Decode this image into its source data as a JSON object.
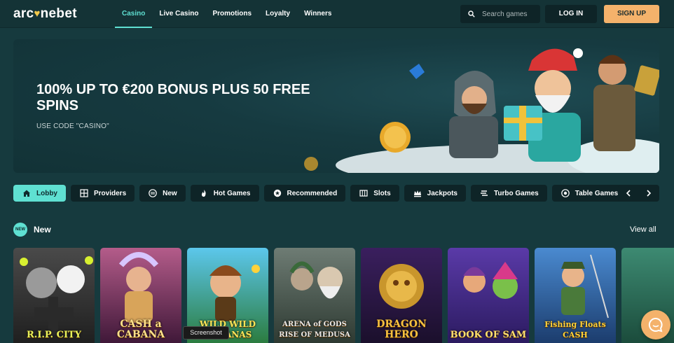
{
  "header": {
    "logo_left": "arc",
    "logo_heart": "♥",
    "logo_right": "nebet",
    "nav": [
      {
        "label": "Casino",
        "active": true
      },
      {
        "label": "Live Casino"
      },
      {
        "label": "Promotions"
      },
      {
        "label": "Loyalty"
      },
      {
        "label": "Winners"
      }
    ],
    "search_placeholder": "Search games",
    "login_label": "LOG IN",
    "signup_label": "SIGN UP"
  },
  "banner": {
    "title": "100% UP TO €200 BONUS PLUS 50 FREE SPINS",
    "subtitle": "USE CODE \"CASINO\""
  },
  "categories": [
    {
      "label": "Lobby",
      "icon": "home-icon",
      "active": true
    },
    {
      "label": "Providers",
      "icon": "grid-icon"
    },
    {
      "label": "New",
      "icon": "new-icon"
    },
    {
      "label": "Hot Games",
      "icon": "flame-icon"
    },
    {
      "label": "Recommended",
      "icon": "star-badge-icon"
    },
    {
      "label": "Slots",
      "icon": "slot-machine-icon"
    },
    {
      "label": "Jackpots",
      "icon": "crown-icon"
    },
    {
      "label": "Turbo Games",
      "icon": "turbo-icon"
    },
    {
      "label": "Table Games",
      "icon": "table-icon"
    }
  ],
  "section": {
    "badge": "NEW",
    "title": "New",
    "view_all": "View all"
  },
  "games": [
    {
      "name": "R.I.P. CITY",
      "bg": "#3a3a3a"
    },
    {
      "name": "CASH a CABANA",
      "bg": "#6a2a55"
    },
    {
      "name": "WILD WILD BANANAS",
      "bg": "#2f8fb8"
    },
    {
      "name": "ARENA of GODS RISE OF MEDUSA",
      "bg": "#4f5b52"
    },
    {
      "name": "DRAGON HERO",
      "bg": "#2b1a3e"
    },
    {
      "name": "BOOK OF SAM",
      "bg": "#3a2a7a"
    },
    {
      "name": "Fishing Floats CASH",
      "bg": "#1d4f86"
    },
    {
      "name": "",
      "bg": "#2c6a58"
    }
  ],
  "tooltip": "Screenshot",
  "colors": {
    "accent": "#5fe0d2",
    "signup": "#f4b26b",
    "background": "#163a3e",
    "dark_panel": "#0e2427"
  }
}
